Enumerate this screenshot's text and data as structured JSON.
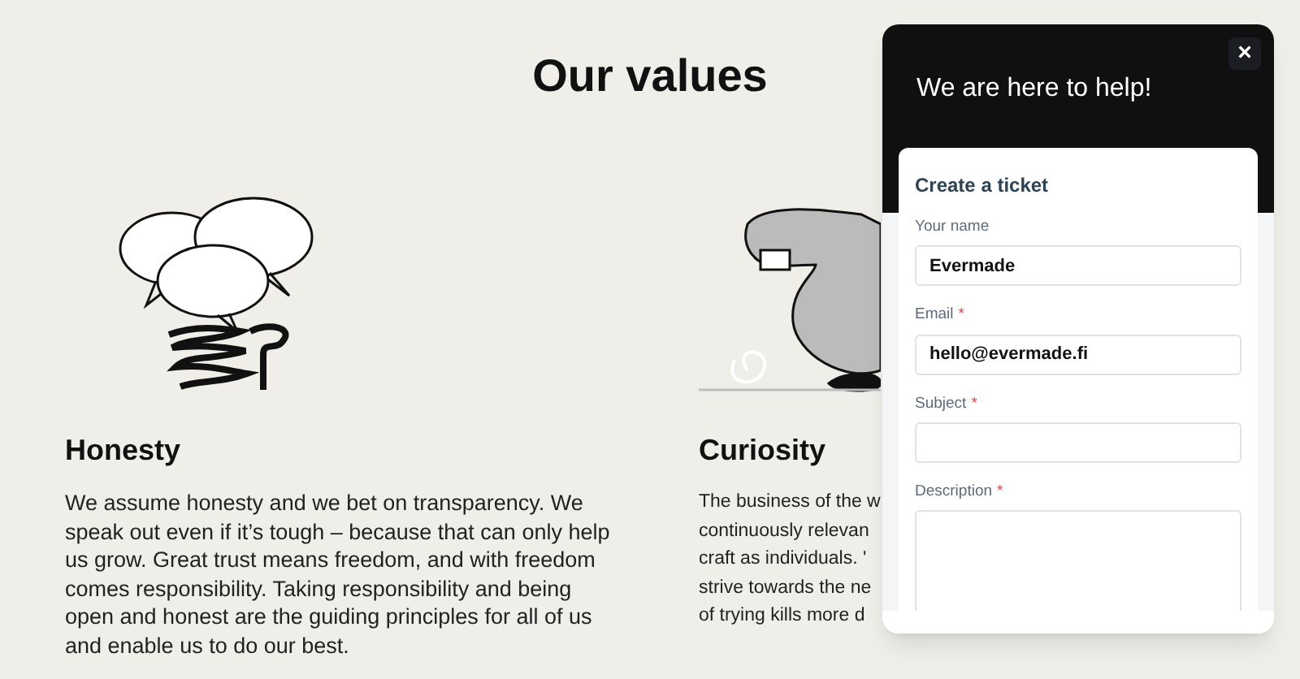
{
  "page": {
    "title": "Our values"
  },
  "values": [
    {
      "heading": "Honesty",
      "lines": [
        "We assume honesty and we bet on transparency. We speak out even if it’s tough – because that can only help us grow. Great trust means freedom, and with freedom comes responsibility. Taking responsibility and being open and honest are the guiding principles for all of us and enable us to do our best."
      ]
    },
    {
      "heading": "Curiosity",
      "lines": [
        "The business of the w",
        "continuously relevan",
        "craft as individuals. '",
        "strive towards the ne",
        "of trying kills more d"
      ]
    }
  ],
  "help_widget": {
    "title": "We are here to help!",
    "close": "×",
    "form_title": "Create a ticket",
    "fields": [
      {
        "label": "Your name",
        "kind": "input",
        "value": "Evermade"
      },
      {
        "label": "Email",
        "required_mark": "*",
        "kind": "input",
        "value": "hello@evermade.fi"
      },
      {
        "label": "Subject",
        "required_mark": "*",
        "kind": "input"
      },
      {
        "label": "Description",
        "required_mark": "*",
        "kind": "textarea"
      }
    ]
  }
}
